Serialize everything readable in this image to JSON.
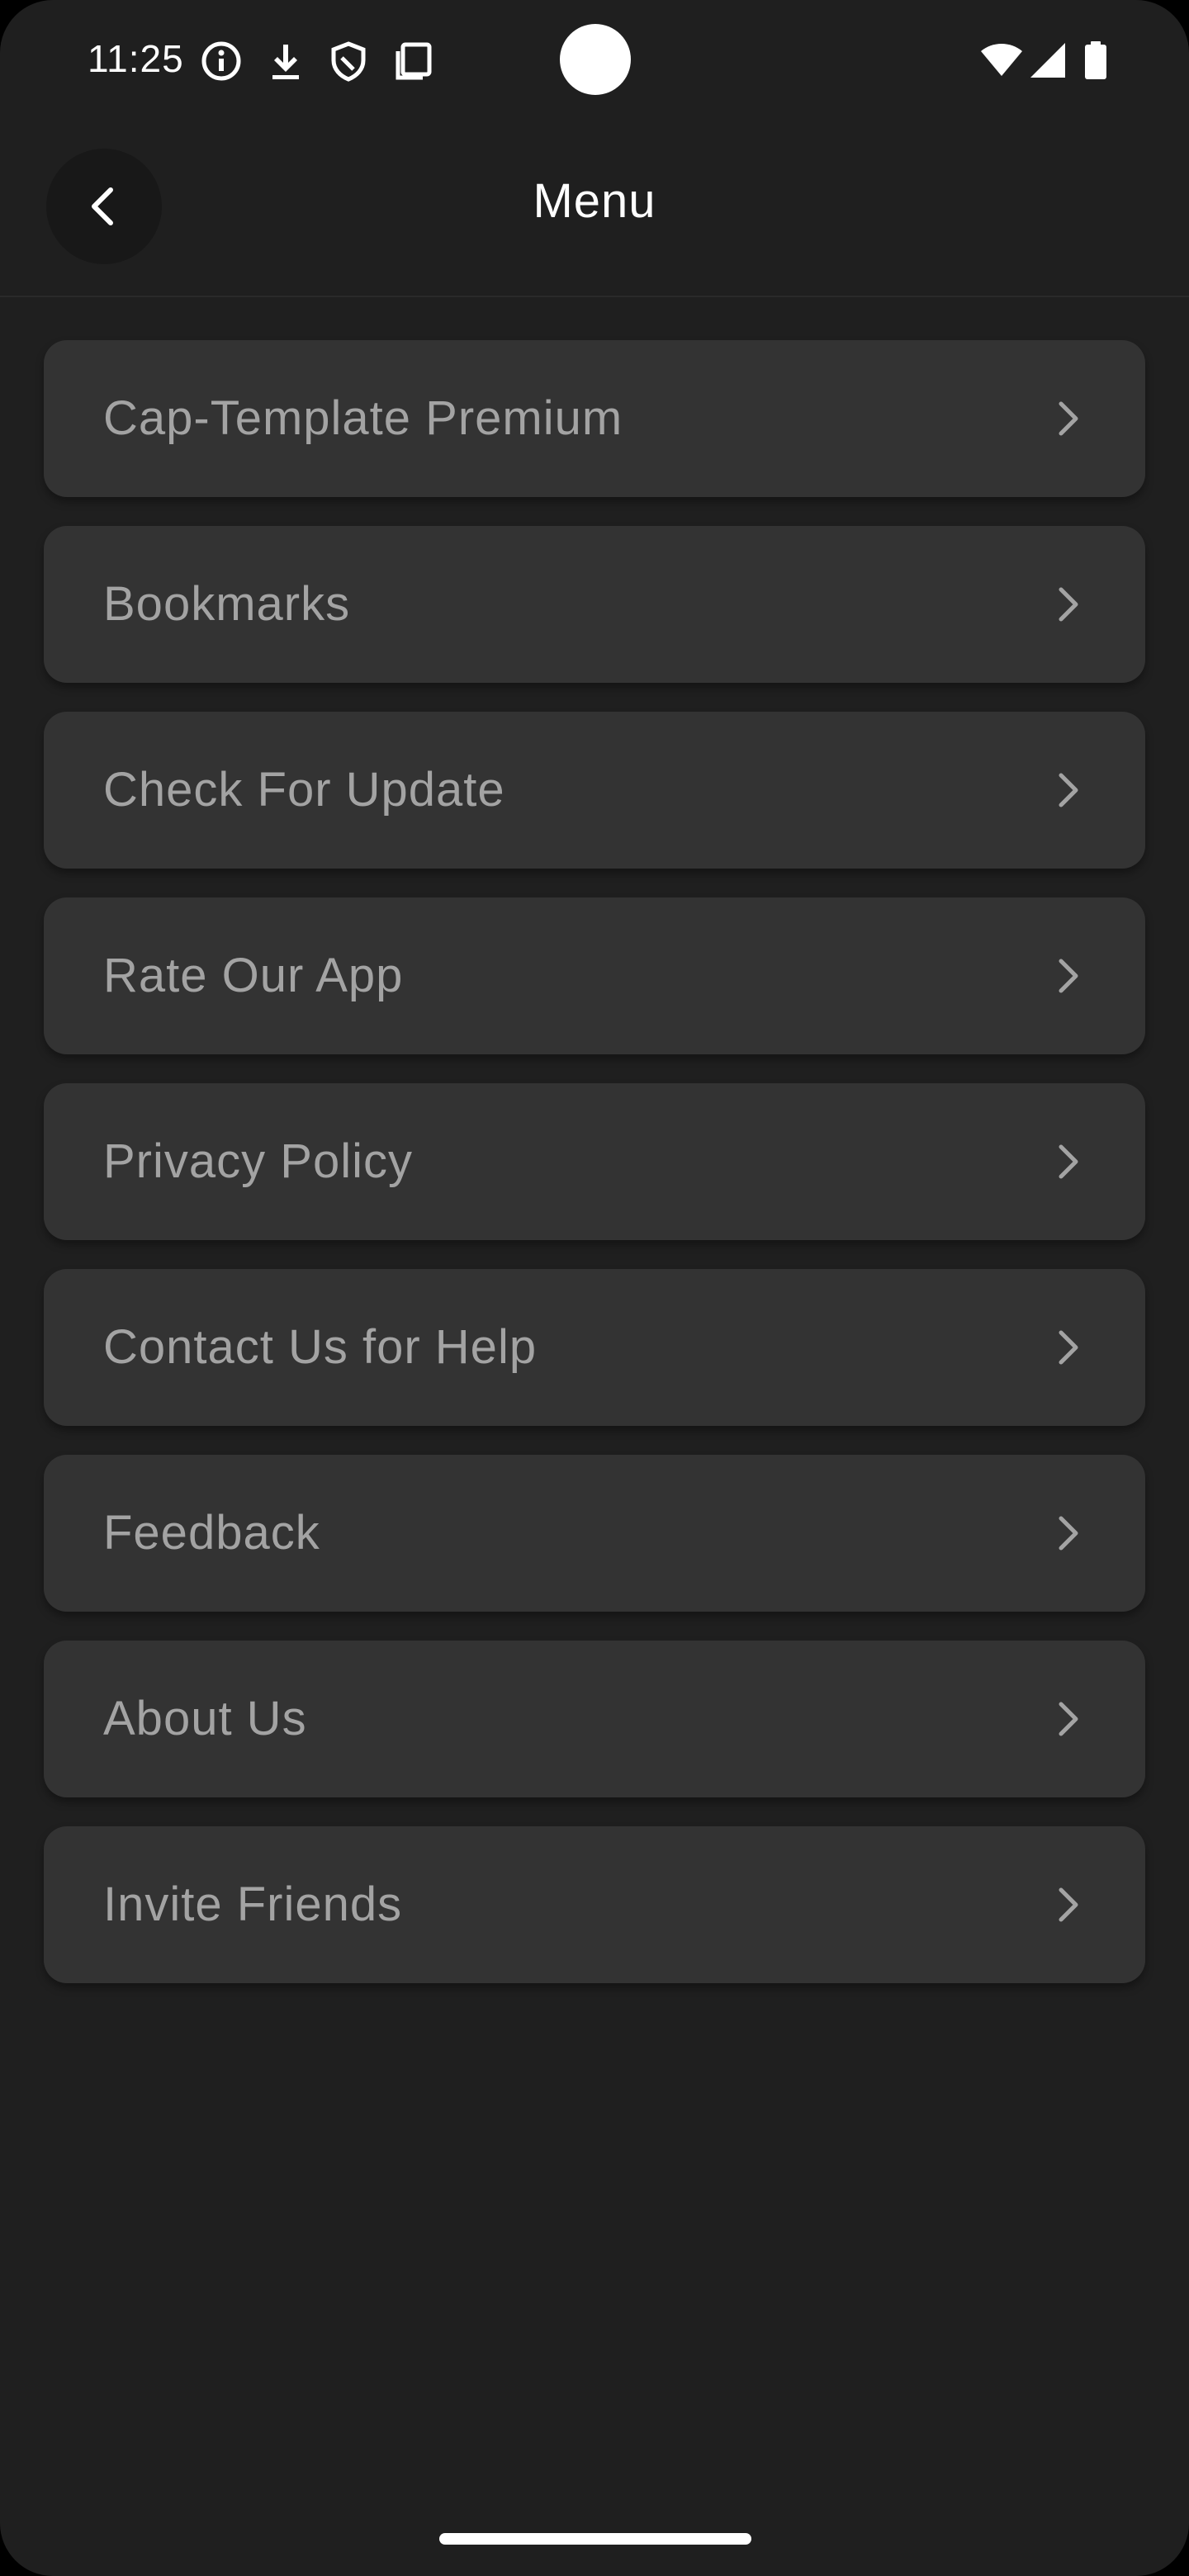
{
  "status_bar": {
    "time": "11:25",
    "icons": [
      "info-icon",
      "download-icon",
      "shield-icon",
      "screenshot-icon",
      "wifi-icon",
      "signal-icon",
      "battery-icon"
    ]
  },
  "app_bar": {
    "title": "Menu",
    "back_icon": "chevron-left-icon"
  },
  "menu": {
    "items": [
      {
        "label": "Cap-Template Premium"
      },
      {
        "label": "Bookmarks"
      },
      {
        "label": "Check For Update"
      },
      {
        "label": "Rate Our App"
      },
      {
        "label": "Privacy Policy"
      },
      {
        "label": "Contact Us for Help"
      },
      {
        "label": "Feedback"
      },
      {
        "label": "About Us"
      },
      {
        "label": "Invite Friends"
      }
    ],
    "chevron_icon": "chevron-right-icon"
  },
  "colors": {
    "background": "#1f1f1f",
    "card": "#333333",
    "label": "#a3a3a3",
    "title": "#ffffff"
  }
}
